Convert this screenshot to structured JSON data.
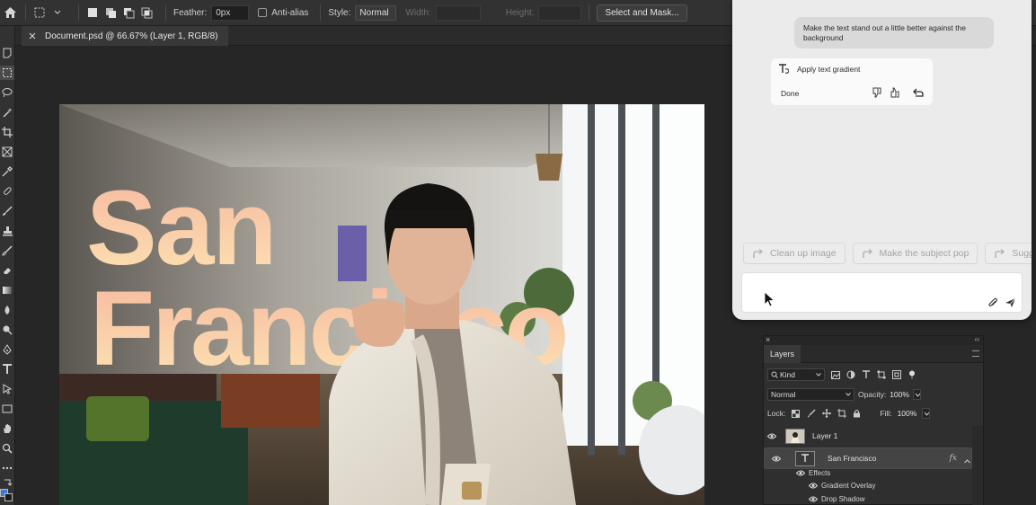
{
  "options_bar": {
    "feather_label": "Feather:",
    "feather_value": "0px",
    "anti_alias_label": "Anti-alias",
    "style_label": "Style:",
    "style_value": "Normal",
    "width_label": "Width:",
    "height_label": "Height:",
    "select_mask_label": "Select and Mask..."
  },
  "document_tab": {
    "title": "Document.psd @ 66.67% (Layer 1, RGB/8)"
  },
  "canvas": {
    "headline_line1": "San",
    "headline_line2": "Francisco"
  },
  "ai_panel": {
    "user_message": "Make the text stand out a little better against the background",
    "response_action": "Apply text gradient",
    "response_status": "Done",
    "suggestions": [
      "Clean up image",
      "Make the subject pop",
      "Sugg"
    ]
  },
  "layers_panel": {
    "tab_label": "Layers",
    "filter_label": "Kind",
    "blend_mode": "Normal",
    "opacity_label": "Opacity:",
    "opacity_value": "100%",
    "lock_label": "Lock:",
    "fill_label": "Fill:",
    "fill_value": "100%",
    "layers": [
      {
        "name": "Layer 1"
      },
      {
        "name": "San Francisco",
        "fx": "fx"
      }
    ],
    "effects_label": "Effects",
    "effects": [
      "Gradient Overlay",
      "Drop Shadow"
    ]
  },
  "colors": {
    "accent": "#3b7bd4",
    "gradient_top": "#f6b8a0",
    "gradient_bottom": "#fde3b2"
  }
}
